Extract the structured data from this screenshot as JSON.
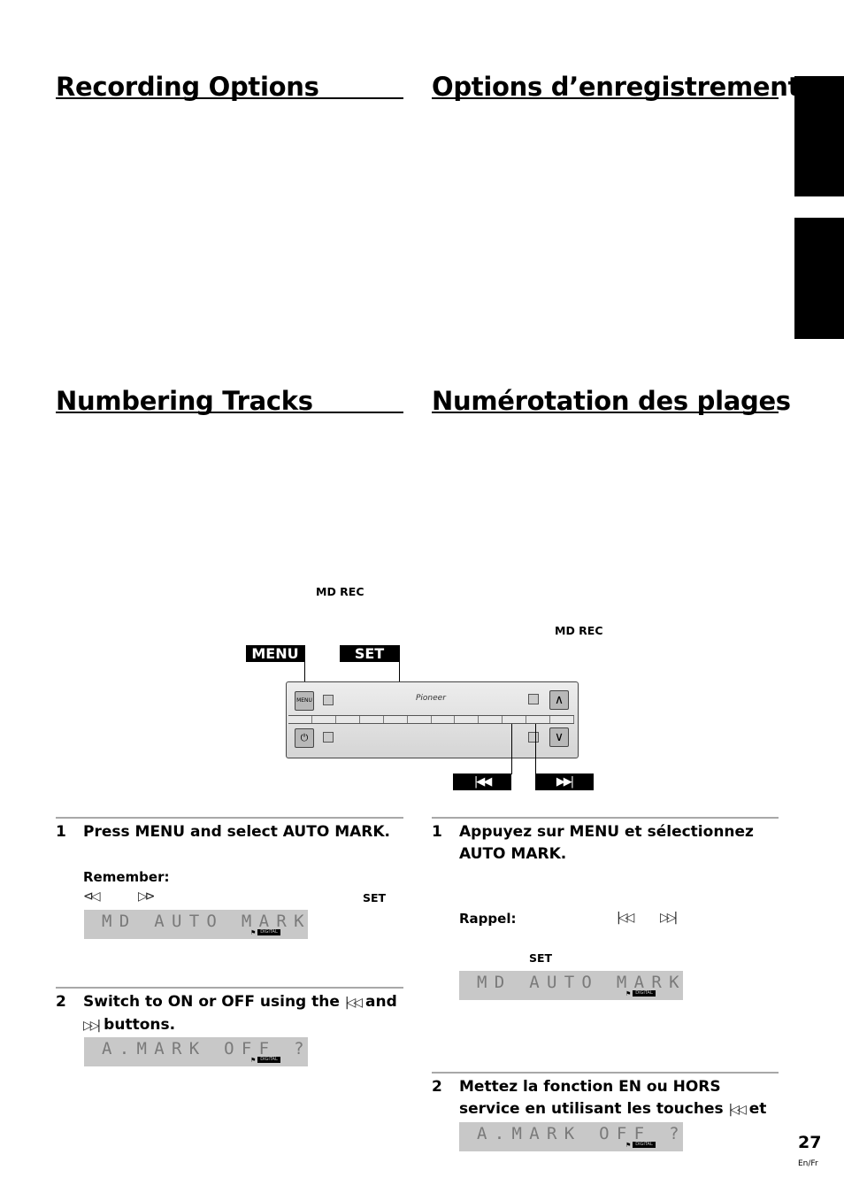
{
  "english": {
    "recording_options": {
      "title": "Recording Options"
    },
    "numbering_tracks": {
      "title": "Numbering Tracks"
    },
    "md_rec_label": "MD REC",
    "steps": [
      {
        "num": "1",
        "text": "Press MENU and select AUTO MARK.",
        "remember_label": "Remember:",
        "remember_icons": [
          "⊲◁",
          "▷⊳"
        ],
        "set_label": "SET",
        "lcd": {
          "text": "MD AUTO MARK",
          "badge": "DIGITAL"
        }
      },
      {
        "num": "2",
        "text_a": "Switch to ON or OFF using the",
        "icon_prev": "|◁◁",
        "text_b": "and",
        "icon_next": "▷▷|",
        "text_c": "buttons.",
        "lcd": {
          "text": "A.MARK OFF ?",
          "badge": "DIGITAL"
        }
      }
    ]
  },
  "french": {
    "recording_options": {
      "title": "Options d’enregistrement"
    },
    "numbering_tracks": {
      "title": "Numérotation des plages"
    },
    "md_rec_label": "MD REC",
    "steps": [
      {
        "num": "1",
        "text": "Appuyez sur MENU et sélectionnez AUTO MARK.",
        "rappel_label": "Rappel:",
        "rappel_icons": [
          "|◁◁",
          "▷▷|"
        ],
        "set_label": "SET",
        "lcd": {
          "text": "MD AUTO MARK",
          "badge": "DIGITAL"
        }
      },
      {
        "num": "2",
        "text_a": "Mettez la fonction EN ou HORS service en utilisant les touches",
        "icon_prev": "|◁◁",
        "text_b": "et",
        "icon_next": "▷▷|",
        "text_c": ".",
        "lcd": {
          "text": "A.MARK OFF ?",
          "badge": "DIGITAL"
        }
      }
    ]
  },
  "diagram": {
    "menu_tag": "MENU",
    "set_tag": "SET",
    "prev_tag": "|◀◀",
    "next_tag": "▶▶|",
    "panel": {
      "brand": "Pioneer",
      "menu_button": "MENU",
      "up_button": "∧",
      "down_button": "∨",
      "power_button": "⏻"
    }
  },
  "footer": {
    "page_number": "27",
    "lang": "En/Fr"
  }
}
